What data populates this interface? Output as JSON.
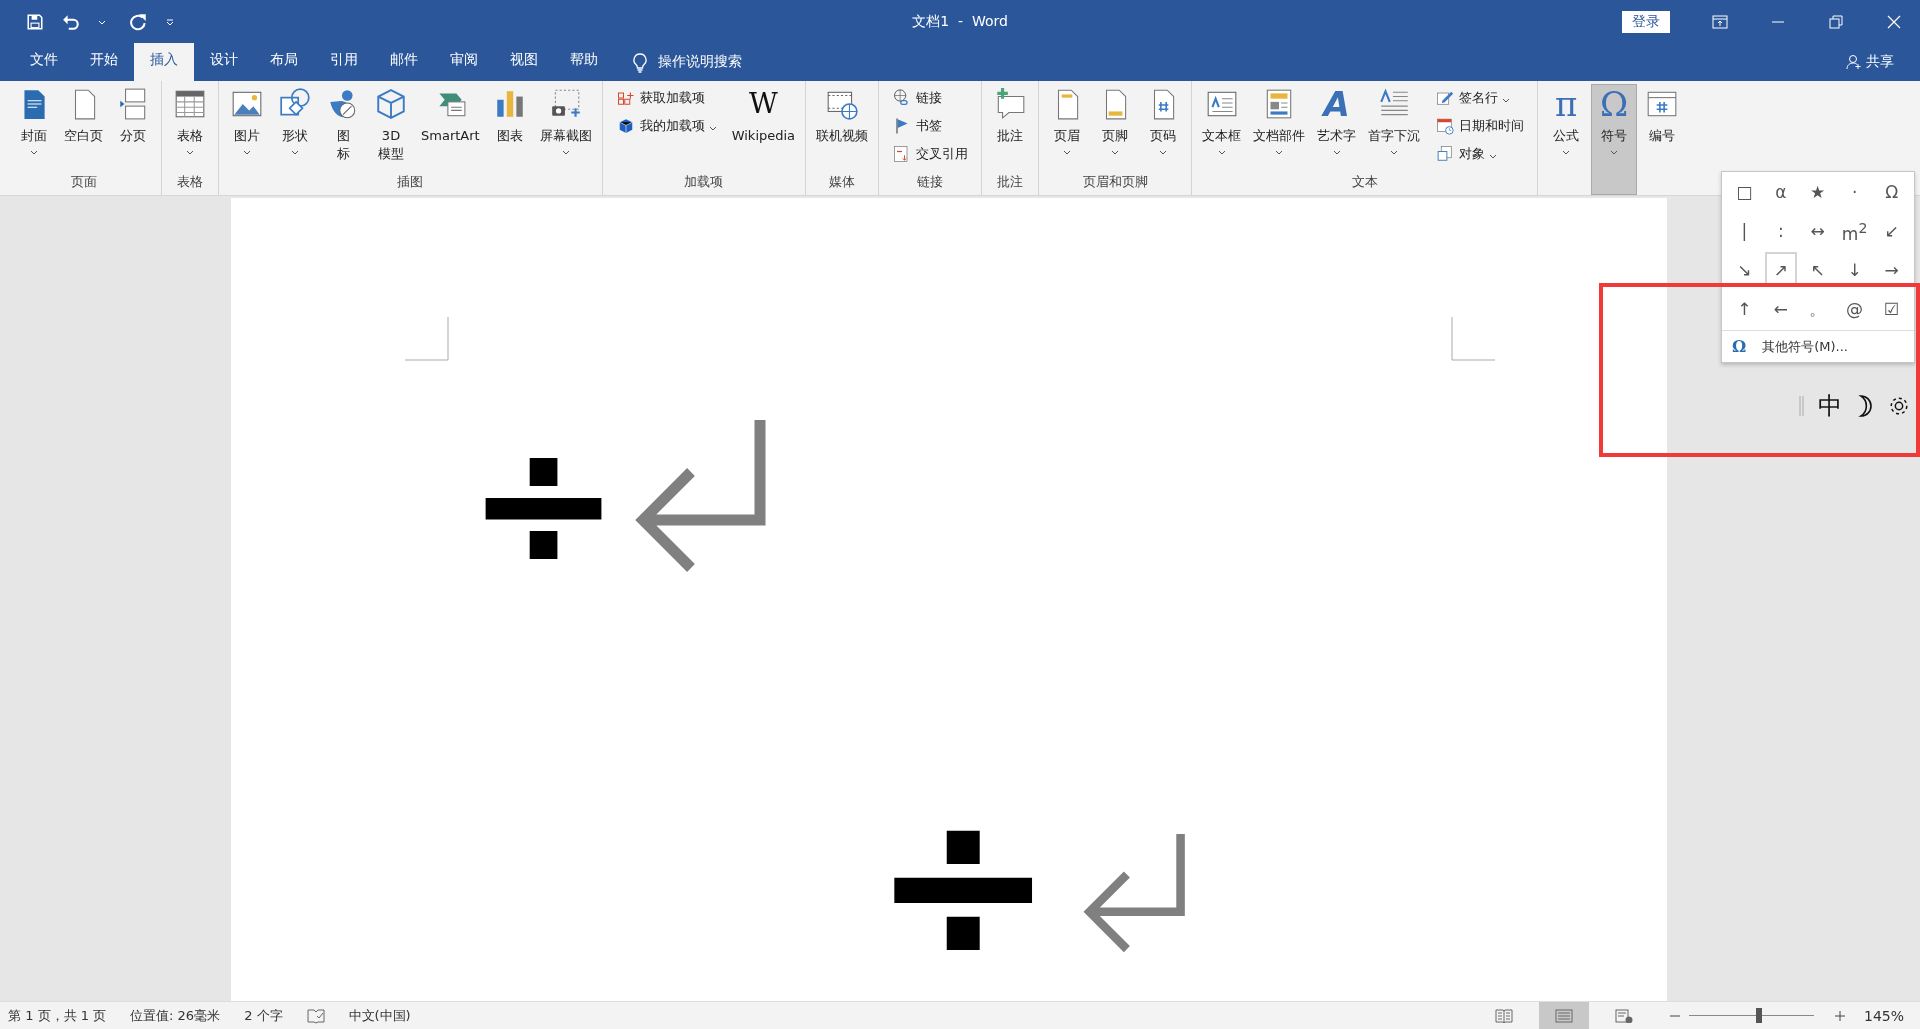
{
  "window": {
    "title": "文档1  -  Word",
    "sign_in": "登录",
    "share": "共享"
  },
  "tabs": [
    {
      "label": "文件",
      "selected": false
    },
    {
      "label": "开始",
      "selected": false
    },
    {
      "label": "插入",
      "selected": true
    },
    {
      "label": "设计",
      "selected": false
    },
    {
      "label": "布局",
      "selected": false
    },
    {
      "label": "引用",
      "selected": false
    },
    {
      "label": "邮件",
      "selected": false
    },
    {
      "label": "审阅",
      "selected": false
    },
    {
      "label": "视图",
      "selected": false
    },
    {
      "label": "帮助",
      "selected": false
    }
  ],
  "tell_me": "操作说明搜索",
  "ribbon": [
    {
      "label": "页面",
      "items": [
        {
          "kind": "large",
          "label": "封面",
          "caret": true
        },
        {
          "kind": "large",
          "label": "空白页",
          "caret": false
        },
        {
          "kind": "large",
          "label": "分页",
          "caret": false
        }
      ]
    },
    {
      "label": "表格",
      "items": [
        {
          "kind": "large",
          "label": "表格",
          "caret": true
        }
      ]
    },
    {
      "label": "插图",
      "items": [
        {
          "kind": "large",
          "label": "图片",
          "caret": true
        },
        {
          "kind": "large",
          "label": "形状",
          "caret": true
        },
        {
          "kind": "large",
          "label": [
            "图",
            "标"
          ],
          "caret": false
        },
        {
          "kind": "large",
          "label": [
            "3D",
            "模型"
          ],
          "caret": false
        },
        {
          "kind": "large",
          "label": "SmartArt",
          "caret": false
        },
        {
          "kind": "large",
          "label": "图表",
          "caret": false
        },
        {
          "kind": "large",
          "label": "屏幕截图",
          "caret": true
        }
      ]
    },
    {
      "label": "加载项",
      "items": [
        {
          "kind": "small",
          "label": "获取加载项",
          "caret": false
        },
        {
          "kind": "small",
          "label": "我的加载项",
          "caret": true
        },
        {
          "kind": "large",
          "label": "Wikipedia",
          "caret": false,
          "glyph": "W"
        }
      ]
    },
    {
      "label": "媒体",
      "items": [
        {
          "kind": "large",
          "label": "联机视频",
          "caret": false
        }
      ]
    },
    {
      "label": "链接",
      "items": [
        {
          "kind": "small",
          "label": "链接",
          "caret": false
        },
        {
          "kind": "small",
          "label": "书签",
          "caret": false
        },
        {
          "kind": "small",
          "label": "交叉引用",
          "caret": false
        }
      ]
    },
    {
      "label": "批注",
      "items": [
        {
          "kind": "large",
          "label": "批注",
          "caret": false
        }
      ]
    },
    {
      "label": "页眉和页脚",
      "items": [
        {
          "kind": "large",
          "label": "页眉",
          "caret": true
        },
        {
          "kind": "large",
          "label": "页脚",
          "caret": true
        },
        {
          "kind": "large",
          "label": "页码",
          "caret": true
        }
      ]
    },
    {
      "label": "文本",
      "items": [
        {
          "kind": "large",
          "label": "文本框",
          "caret": true
        },
        {
          "kind": "large",
          "label": "文档部件",
          "caret": true
        },
        {
          "kind": "large",
          "label": "艺术字",
          "caret": true,
          "glyph": "A"
        },
        {
          "kind": "large",
          "label": "首字下沉",
          "caret": true
        },
        {
          "kind": "small",
          "label": "签名行",
          "caret": true
        },
        {
          "kind": "small",
          "label": "日期和时间",
          "caret": false
        },
        {
          "kind": "small",
          "label": "对象",
          "caret": true
        }
      ]
    },
    {
      "items": [
        {
          "kind": "large",
          "label": "公式",
          "caret": true,
          "glyph": "π",
          "pressed": false
        },
        {
          "kind": "large",
          "label": "符号",
          "caret": true,
          "glyph": "Ω",
          "pressed": true
        },
        {
          "kind": "large",
          "label": "编号",
          "caret": false,
          "pressed": false
        }
      ]
    }
  ],
  "symbol_menu": {
    "symbols": [
      {
        "char": "□",
        "selected": false
      },
      {
        "char": "α",
        "selected": false
      },
      {
        "char": "★",
        "selected": false
      },
      {
        "char": "·",
        "selected": false
      },
      {
        "char": "Ω",
        "selected": false
      },
      {
        "char": "|",
        "selected": false
      },
      {
        "char": ":",
        "selected": false
      },
      {
        "char": "↔",
        "selected": false
      },
      {
        "char": "m$^{2}$",
        "selected": false
      },
      {
        "char": "↙",
        "selected": false
      },
      {
        "char": "↘",
        "selected": false
      },
      {
        "char": "↗",
        "selected": true
      },
      {
        "char": "↖",
        "selected": false
      },
      {
        "char": "↓",
        "selected": false
      },
      {
        "char": "→",
        "selected": false
      },
      {
        "char": "↑",
        "selected": false
      },
      {
        "char": "←",
        "selected": false
      },
      {
        "char": "。",
        "selected": false
      },
      {
        "char": "@",
        "selected": false
      },
      {
        "char": "☑",
        "selected": false
      }
    ],
    "more": {
      "glyph": "Ω",
      "label": "其他符号(M)..."
    }
  },
  "ime_toolbar": {
    "mode": "中"
  },
  "document": {
    "paragraphs": [
      {
        "text": "÷"
      },
      {
        "text": "÷"
      }
    ]
  },
  "status_bar": {
    "items": [
      "第 1 页，共 1 页",
      "位置值: 26毫米",
      "2 个字"
    ],
    "language": "中文(中国)",
    "views": [
      {
        "selected": false
      },
      {
        "selected": true
      },
      {
        "selected": false
      }
    ],
    "zoom": {
      "level": 0.56,
      "reading": "145%"
    }
  }
}
